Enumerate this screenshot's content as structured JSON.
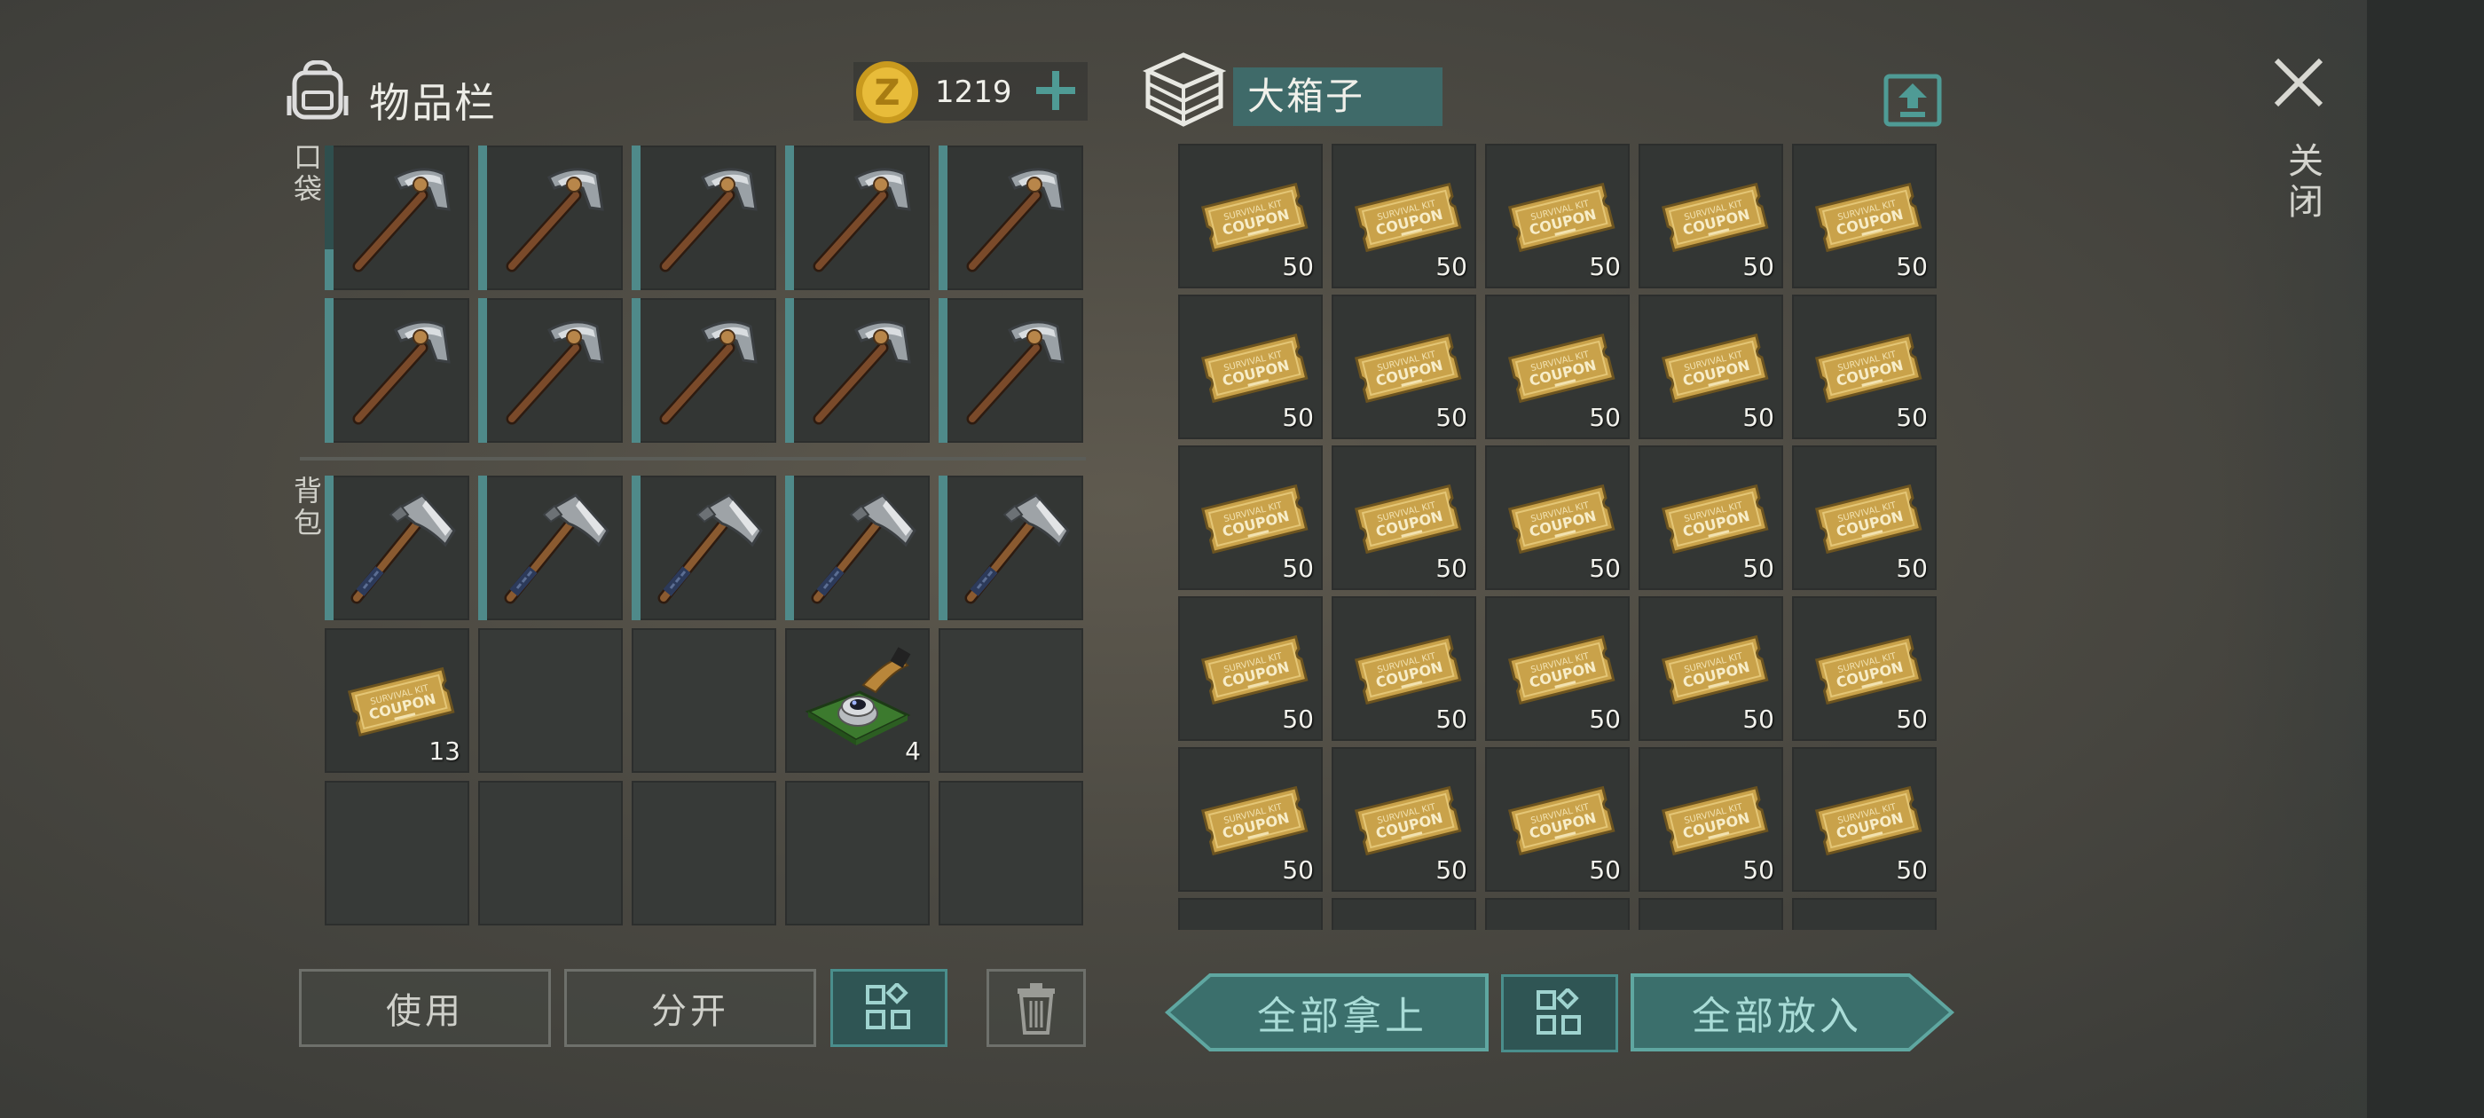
{
  "inventory": {
    "title": "物品栏",
    "money": "1219",
    "pocket_label": "口袋",
    "backpack_label": "背包",
    "pocket_items": [
      {
        "item": "pickaxe",
        "durability": 0.28
      },
      {
        "item": "pickaxe",
        "durability": 1.0
      },
      {
        "item": "pickaxe",
        "durability": 1.0
      },
      {
        "item": "pickaxe",
        "durability": 1.0
      },
      {
        "item": "pickaxe",
        "durability": 1.0
      },
      {
        "item": "pickaxe",
        "durability": 1.0
      },
      {
        "item": "pickaxe",
        "durability": 1.0
      },
      {
        "item": "pickaxe",
        "durability": 1.0
      },
      {
        "item": "pickaxe",
        "durability": 1.0
      },
      {
        "item": "pickaxe",
        "durability": 1.0
      }
    ],
    "backpack_items": [
      {
        "item": "hatchet",
        "durability": 1.0
      },
      {
        "item": "hatchet",
        "durability": 1.0
      },
      {
        "item": "hatchet",
        "durability": 1.0
      },
      {
        "item": "hatchet",
        "durability": 1.0
      },
      {
        "item": "hatchet",
        "durability": 1.0
      },
      {
        "item": "coupon",
        "count": "13"
      },
      {
        "item": "empty"
      },
      {
        "item": "empty"
      },
      {
        "item": "camera-module",
        "count": "4"
      },
      {
        "item": "empty"
      },
      {
        "item": "empty"
      },
      {
        "item": "empty"
      },
      {
        "item": "empty"
      },
      {
        "item": "empty"
      },
      {
        "item": "empty"
      }
    ],
    "buttons": {
      "use": "使用",
      "split": "分开"
    }
  },
  "chest": {
    "title": "大箱子",
    "slot_count": "50",
    "take_all": "全部拿上",
    "put_all": "全部放入"
  },
  "close_label": "关闭",
  "colors": {
    "accent": "#4f8a8a",
    "teal_button": "#2f5554",
    "coupon_gold": "#c9a24a"
  }
}
